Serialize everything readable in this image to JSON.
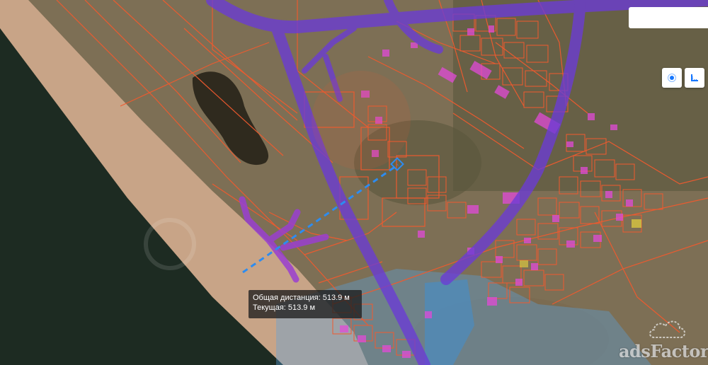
{
  "map": {
    "colors": {
      "sea": "#1c2a20",
      "beach": "#cba88a",
      "land": "#8a7a5c",
      "parcel_outline": "#f05a2e",
      "parcel_fill": "#e24ad8",
      "road_overlay": "#6b3bd6",
      "water_zone": "#3b8fd8",
      "measure_line": "#2d8cf0"
    }
  },
  "search": {
    "placeholder": "",
    "value": ""
  },
  "controls": {
    "locate_icon": "locate-icon",
    "ruler_icon": "ruler-icon",
    "active_color": "#1677ff"
  },
  "measure": {
    "total_text": "Общая дистанция: 513.9 м",
    "current_text": "Текущая: 513.9 м"
  },
  "watermark": {
    "text": "adsFactory",
    "icon": "cloud-icon"
  }
}
